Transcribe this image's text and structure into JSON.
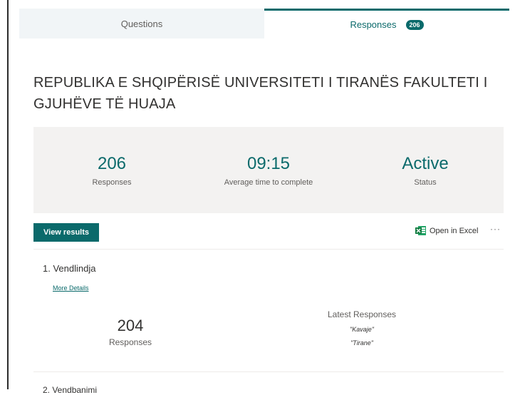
{
  "tabs": [
    {
      "label": "Questions"
    },
    {
      "label": "Responses",
      "badge": "206"
    }
  ],
  "form_title": "REPUBLIKA E SHQIPËRISË UNIVERSITETI I TIRANËS FAKULTETI I GJUHËVE TË HUAJA",
  "stats": [
    {
      "value": "206",
      "label": "Responses"
    },
    {
      "value": "09:15",
      "label": "Average time to complete"
    },
    {
      "value": "Active",
      "label": "Status"
    }
  ],
  "actions": {
    "view_results": "View results",
    "open_in_excel": "Open in Excel",
    "more": "···"
  },
  "questions": [
    {
      "title": "1. Vendlindja",
      "details_link": "More Details",
      "response_count": "204",
      "response_label": "Responses",
      "latest_header": "Latest Responses",
      "latest": [
        "\"Kavaje\"",
        "\"Tirane\""
      ]
    },
    {
      "title": "2. Vendbanimi"
    }
  ],
  "colors": {
    "accent": "#0b6a6b",
    "stats_bg": "#f3f2f1",
    "tab_inactive_bg": "#f1f5f7"
  }
}
